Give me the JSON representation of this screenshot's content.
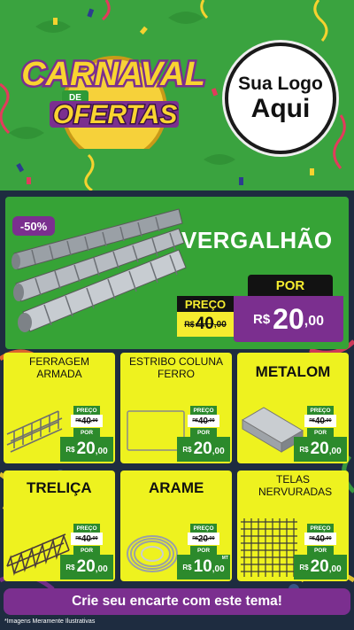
{
  "header": {
    "logo_line1": "CARNAVAL",
    "logo_line2": "DE",
    "logo_line3": "OFERTAS",
    "your_logo_line1": "Sua Logo",
    "your_logo_line2": "Aqui"
  },
  "hero": {
    "discount": "-50%",
    "product": "VERGALHÃO",
    "por_label": "POR",
    "preco_label": "PREÇO",
    "old_currency": "R$",
    "old_int": "40",
    "old_dec": ",00",
    "new_currency": "R$",
    "new_int": "20",
    "new_dec": ",00"
  },
  "products": [
    {
      "name": "FERRAGEM ARMADA",
      "preco_label": "PREÇO",
      "old_currency": "R$",
      "old_int": "40",
      "old_dec": ",00",
      "por_label": "POR",
      "new_currency": "R$",
      "new_int": "20",
      "new_dec": ",00"
    },
    {
      "name": "ESTRIBO COLUNA FERRO",
      "preco_label": "PREÇO",
      "old_currency": "R$",
      "old_int": "40",
      "old_dec": ",00",
      "por_label": "POR",
      "new_currency": "R$",
      "new_int": "20",
      "new_dec": ",00"
    },
    {
      "name": "METALOM",
      "preco_label": "PREÇO",
      "old_currency": "R$",
      "old_int": "40",
      "old_dec": ",00",
      "por_label": "POR",
      "new_currency": "R$",
      "new_int": "20",
      "new_dec": ",00"
    },
    {
      "name": "TRELIÇA",
      "preco_label": "PREÇO",
      "old_currency": "R$",
      "old_int": "40",
      "old_dec": ",00",
      "por_label": "POR",
      "new_currency": "R$",
      "new_int": "20",
      "new_dec": ",00"
    },
    {
      "name": "ARAME",
      "preco_label": "PREÇO",
      "old_currency": "R$",
      "old_int": "20",
      "old_dec": ",00",
      "por_label": "POR",
      "new_currency": "R$",
      "new_int": "10",
      "new_dec": ",00",
      "unit": "MT"
    },
    {
      "name": "TELAS NERVURADAS",
      "preco_label": "PREÇO",
      "old_currency": "R$",
      "old_int": "40",
      "old_dec": ",00",
      "por_label": "POR",
      "new_currency": "R$",
      "new_int": "20",
      "new_dec": ",00"
    }
  ],
  "cta_label": "Crie seu encarte com este tema!",
  "disclaimer": "*Imagens Meramente Ilustrativas",
  "colors": {
    "green": "#3aa33f",
    "yellow": "#eef21f",
    "purple": "#7b2f8f",
    "dark": "#1e2c40",
    "price_green": "#2c8a2c"
  },
  "icons": [
    "tambourine-icon",
    "carnival-mask-icon",
    "confetti-icon",
    "streamer-icon",
    "rebar-image",
    "mesh-image",
    "wire-coil-image"
  ]
}
